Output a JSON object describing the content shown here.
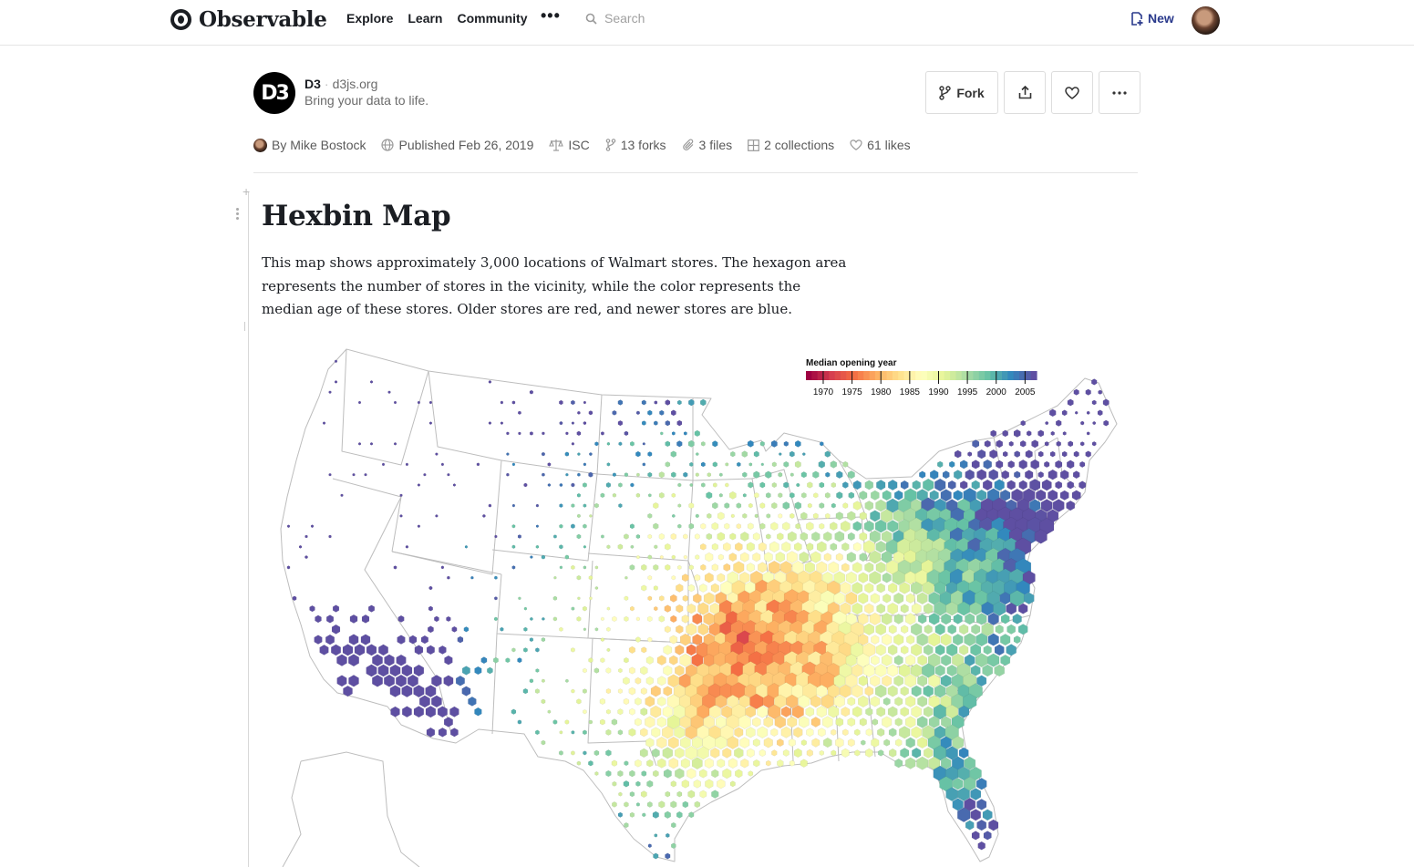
{
  "nav": {
    "brand": "Observable",
    "links": [
      "Explore",
      "Learn",
      "Community"
    ],
    "more": "•••",
    "search_placeholder": "Search",
    "new_label": "New"
  },
  "header": {
    "owner_logo": "D3",
    "owner_name": "D3",
    "owner_site": "d3js.org",
    "tagline": "Bring your data to life.",
    "fork_label": "Fork"
  },
  "meta": {
    "author": "By Mike Bostock",
    "published": "Published Feb 26, 2019",
    "license": "ISC",
    "forks": "13 forks",
    "files": "3 files",
    "collections": "2 collections",
    "likes": "61 likes"
  },
  "notebook": {
    "title": "Hexbin Map",
    "description": "This map shows approximately 3,000 locations of Walmart stores. The hexagon area represents the number of stores in the vicinity, while the color represents the median age of these stores. Older stores are red, and newer stores are blue."
  },
  "legend": {
    "title": "Median opening year",
    "ticks": [
      "1970",
      "1975",
      "1980",
      "1985",
      "1990",
      "1995",
      "2000",
      "2005"
    ],
    "domain": [
      1967,
      2007
    ]
  },
  "colors": {
    "accent": "#2a3a8c",
    "border": "#dddddd",
    "state_lines": "#bdbdbd"
  }
}
